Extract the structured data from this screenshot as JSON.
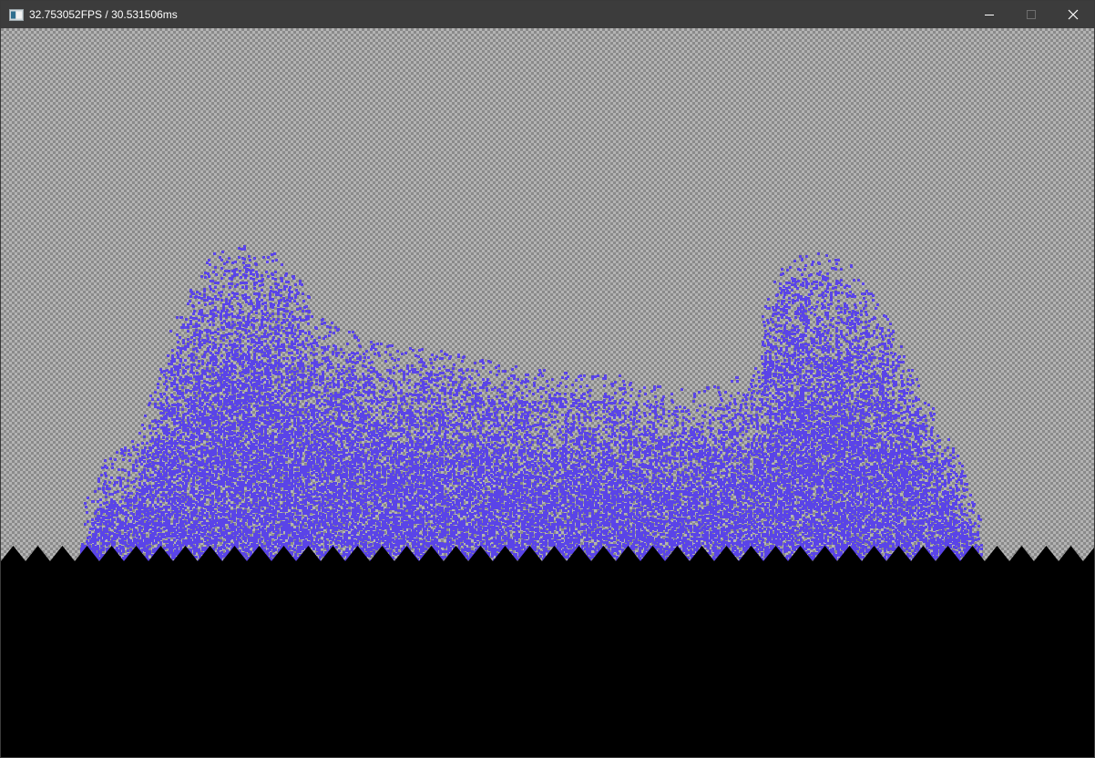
{
  "window": {
    "title": "32.753052FPS / 30.531506ms",
    "icon": "app-window-icon",
    "buttons": {
      "minimize_icon": "minimize-icon",
      "maximize_icon": "maximize-icon",
      "close_icon": "close-icon"
    }
  },
  "simulation": {
    "background_checker_colors": [
      "#8a8a8a",
      "#b4b4b4"
    ],
    "particle_color": "#5a44e8",
    "ground_color": "#000000",
    "particles": "fluid-particles",
    "ground": "zigzag-ground"
  }
}
